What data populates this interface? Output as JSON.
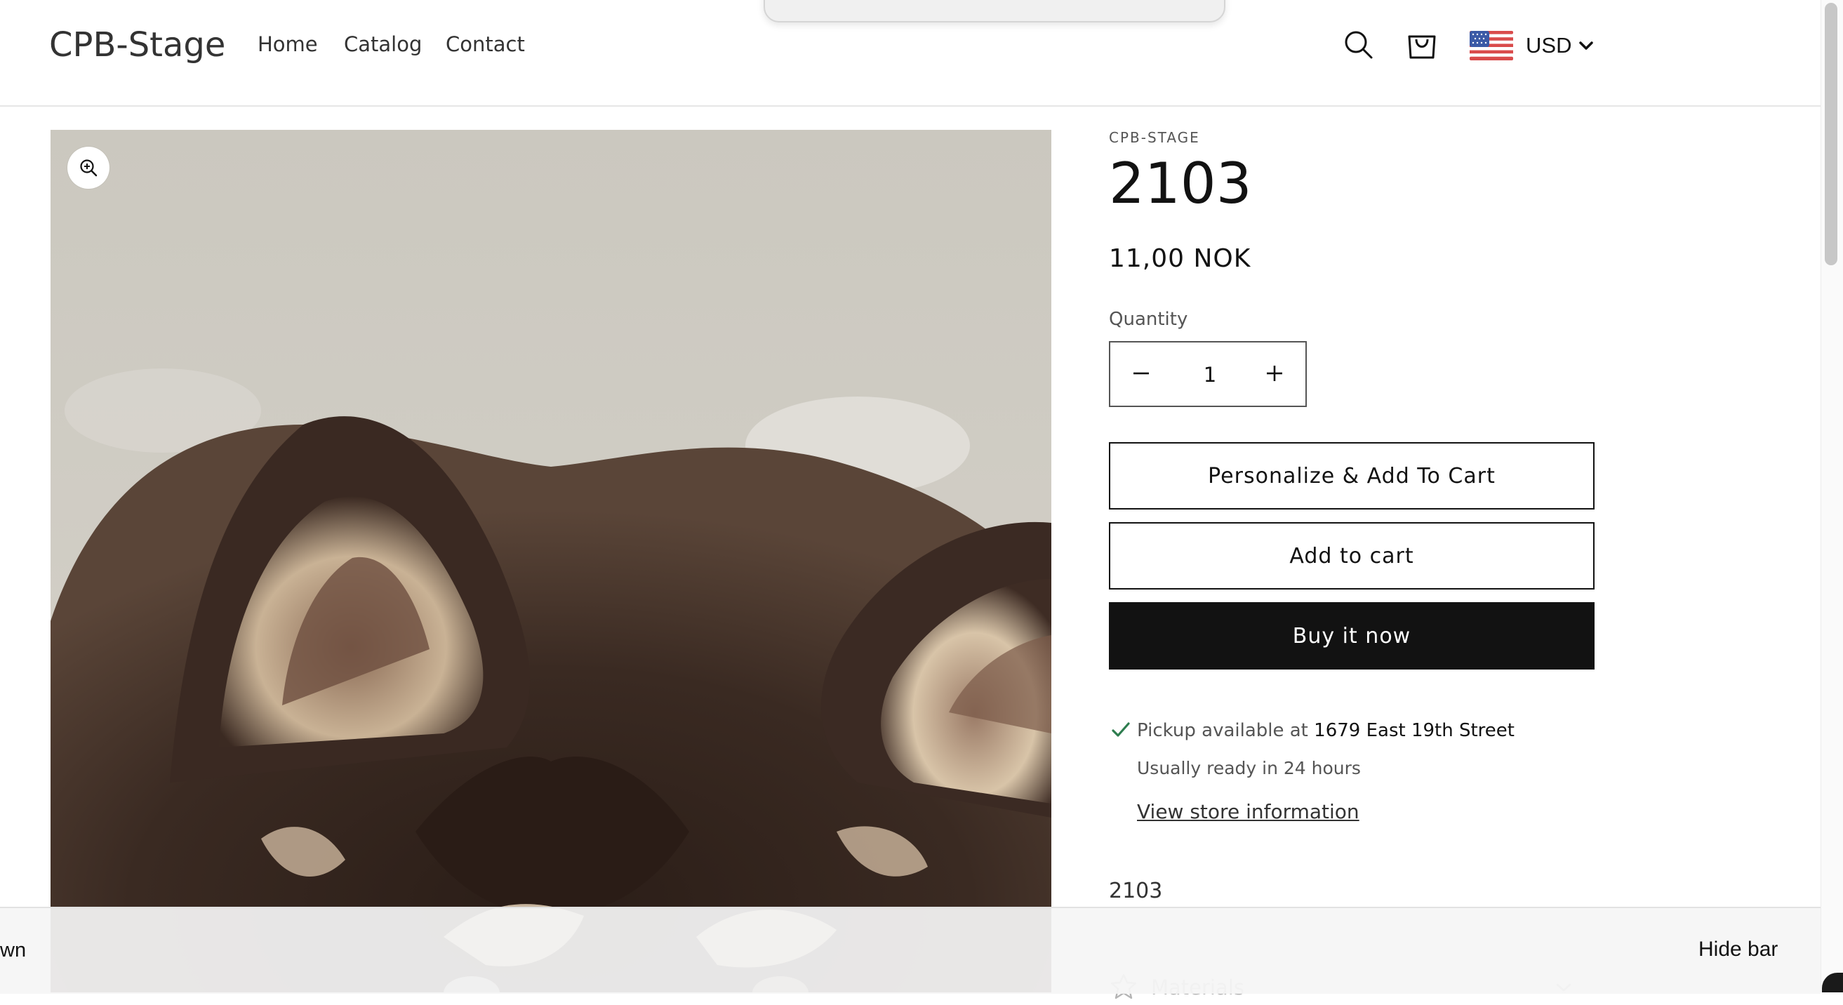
{
  "header": {
    "logo": "CPB-Stage",
    "nav": [
      {
        "label": "Home"
      },
      {
        "label": "Catalog"
      },
      {
        "label": "Contact"
      }
    ],
    "currency": {
      "code": "USD",
      "flag_icon": "us-flag-icon"
    }
  },
  "product": {
    "vendor": "CPB-STAGE",
    "title": "2103",
    "price": "11,00 NOK",
    "quantity_label": "Quantity",
    "quantity_value": "1",
    "personalize_label": "Personalize & Add To Cart",
    "add_to_cart_label": "Add to cart",
    "buy_now_label": "Buy it now",
    "pickup_prefix": "Pickup available at ",
    "pickup_location": "1679 East 19th Street",
    "pickup_ready": "Usually ready in 24 hours",
    "store_info_link": "View store information",
    "description": "2103",
    "materials_label": "Materials"
  },
  "bottom_bar": {
    "left_text": "wn",
    "hide_label": "Hide bar"
  },
  "colors": {
    "text": "#121212",
    "button_dark": "#121212",
    "check_green": "#2e7d4f"
  }
}
